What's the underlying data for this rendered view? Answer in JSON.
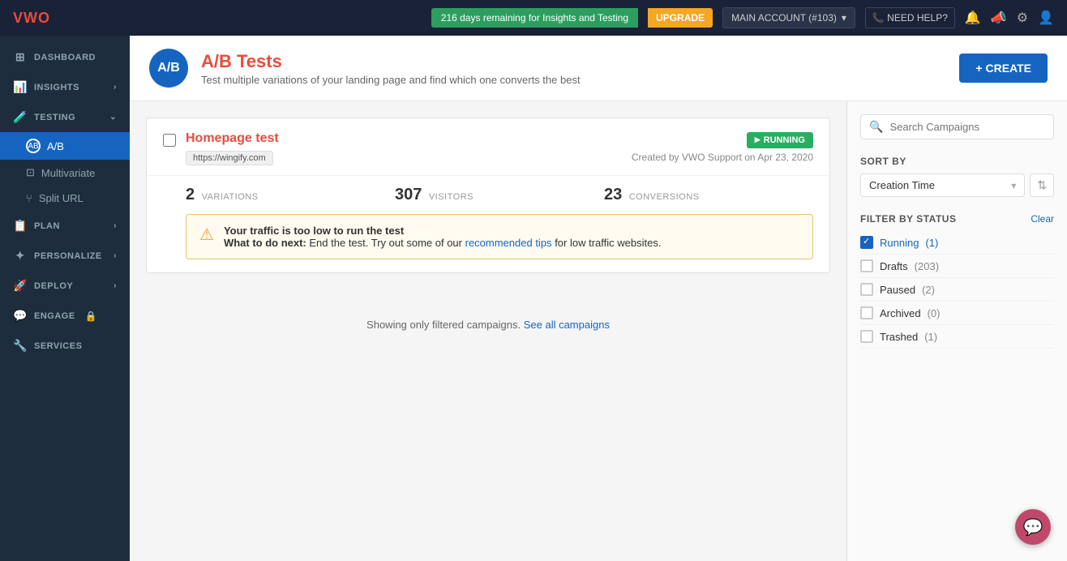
{
  "topbar": {
    "logo": "VWO",
    "trial": {
      "text": "216 days remaining for Insights and Testing",
      "upgrade_label": "UPGRADE"
    },
    "account": {
      "label": "MAIN ACCOUNT (#103)",
      "chevron": "▾"
    },
    "need_help": "📞 NEED HELP?",
    "icons": {
      "bell": "🔔",
      "megaphone": "📣",
      "settings": "⚙",
      "user": "👤"
    }
  },
  "sidebar": {
    "items": [
      {
        "id": "dashboard",
        "label": "DASHBOARD",
        "icon": "⊞",
        "chevron": ""
      },
      {
        "id": "insights",
        "label": "INSIGHTS",
        "icon": "📊",
        "chevron": "›"
      },
      {
        "id": "testing",
        "label": "TESTING",
        "icon": "🧪",
        "chevron": "⌄"
      },
      {
        "id": "ab",
        "label": "A/B",
        "icon": "",
        "chevron": ""
      },
      {
        "id": "multivariate",
        "label": "Multivariate",
        "icon": "",
        "chevron": ""
      },
      {
        "id": "spliturl",
        "label": "Split URL",
        "icon": "",
        "chevron": ""
      },
      {
        "id": "plan",
        "label": "PLAN",
        "icon": "📋",
        "chevron": "›"
      },
      {
        "id": "personalize",
        "label": "PERSONALIZE",
        "icon": "✦",
        "chevron": "›"
      },
      {
        "id": "deploy",
        "label": "DEPLOY",
        "icon": "🚀",
        "chevron": "›"
      },
      {
        "id": "engage",
        "label": "ENGAGE",
        "icon": "💬",
        "chevron": "",
        "lock": "🔒"
      },
      {
        "id": "services",
        "label": "SERVICES",
        "icon": "🔧",
        "chevron": ""
      }
    ]
  },
  "page_header": {
    "avatar_text": "A/B",
    "title": "A/B Tests",
    "subtitle": "Test multiple variations of your landing page and find which one converts the best",
    "create_label": "+ CREATE"
  },
  "campaign": {
    "name": "Homepage test",
    "url": "https://wingify.com",
    "status": "RUNNING",
    "status_play": "▶",
    "created_by": "Created by VWO Support on Apr 23, 2020",
    "variations": {
      "value": "2",
      "label": "VARIATIONS"
    },
    "visitors": {
      "value": "307",
      "label": "VISITORS"
    },
    "conversions": {
      "value": "23",
      "label": "CONVERSIONS"
    },
    "alert": {
      "title": "Your traffic is too low to run the test",
      "next_label": "What to do next:",
      "next_text": " End the test. Try out some of our ",
      "link_text": "recommended tips",
      "link_suffix": " for low traffic websites."
    }
  },
  "filter_info": {
    "text": "Showing only filtered campaigns. ",
    "link_text": "See all campaigns"
  },
  "right_sidebar": {
    "search": {
      "placeholder": "Search Campaigns"
    },
    "sort": {
      "label": "SORT BY",
      "value": "Creation Time"
    },
    "filter": {
      "label": "FILTER BY STATUS",
      "clear_label": "Clear",
      "items": [
        {
          "id": "running",
          "label": "Running",
          "count": "(1)",
          "checked": true
        },
        {
          "id": "drafts",
          "label": "Drafts",
          "count": "(203)",
          "checked": false
        },
        {
          "id": "paused",
          "label": "Paused",
          "count": "(2)",
          "checked": false
        },
        {
          "id": "archived",
          "label": "Archived",
          "count": "(0)",
          "checked": false
        },
        {
          "id": "trashed",
          "label": "Trashed",
          "count": "(1)",
          "checked": false
        }
      ]
    }
  }
}
